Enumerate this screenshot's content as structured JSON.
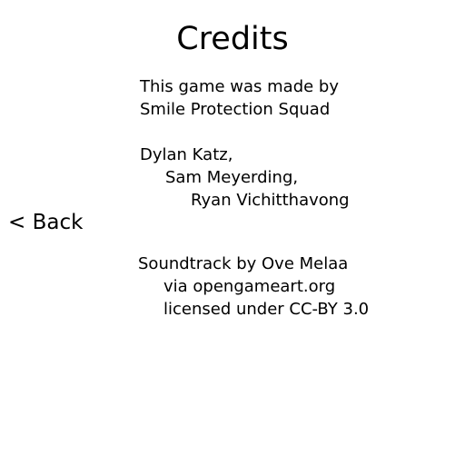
{
  "screen": {
    "title": "Credits",
    "back_label": "< Back"
  },
  "credits": {
    "intro_line1": "This game was made by",
    "intro_line2": "Smile Protection Squad",
    "member1": "Dylan Katz,",
    "member2": "Sam Meyerding,",
    "member3": "Ryan Vichitthavong",
    "soundtrack_line1": "Soundtrack by Ove Melaa",
    "soundtrack_line2": "via opengameart.org",
    "soundtrack_line3": "licensed under CC-BY 3.0"
  }
}
